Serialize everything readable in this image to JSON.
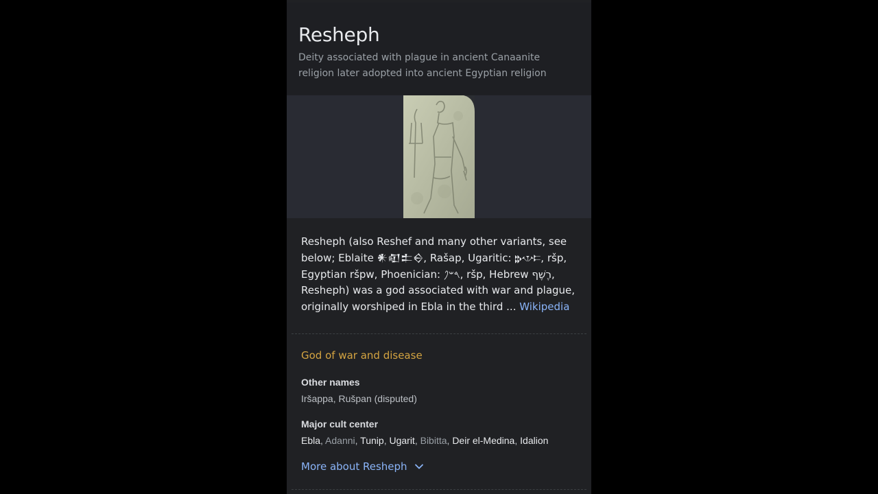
{
  "entity": {
    "title": "Resheph",
    "subtitle": "Deity associated with plague in ancient Canaanite religion later adopted into ancient Egyptian religion"
  },
  "image": {
    "alt_semantic": "resheph-relief-image"
  },
  "description": {
    "text": "Resheph (also Reshef and many other variants, see below; Eblaite 𒀭𒊏𒉺𒀪, Rašap, Ugaritic: 𐎗𐎌𐎔, ršp, Egyptian ršpw, Phoenician: 𐤓𐤔𐤐, ršp, Hebrew רֶשֶׁף, Resheph) was a god associated with war and plague, originally worshiped in Ebla in the third ...",
    "source_link": "Wikipedia"
  },
  "tagline": "God of war and disease",
  "facts": [
    {
      "label": "Other names",
      "value": "Iršappa, Rušpan (disputed)"
    },
    {
      "label": "Major cult center",
      "items": [
        {
          "text": "Ebla",
          "linked": true
        },
        {
          "text": "Adanni",
          "linked": false
        },
        {
          "text": "Tunip",
          "linked": true
        },
        {
          "text": "Ugarit",
          "linked": true
        },
        {
          "text": "Bibitta",
          "linked": false
        },
        {
          "text": "Deir el-Medina",
          "linked": true
        },
        {
          "text": "Idalion",
          "linked": true
        }
      ]
    }
  ],
  "more_link": "More about Resheph",
  "icons": {
    "more": "chevron-down-icon"
  },
  "colors": {
    "panel_bg": "#202124",
    "link": "#8ab4f8",
    "tagline": "#d4a441"
  }
}
